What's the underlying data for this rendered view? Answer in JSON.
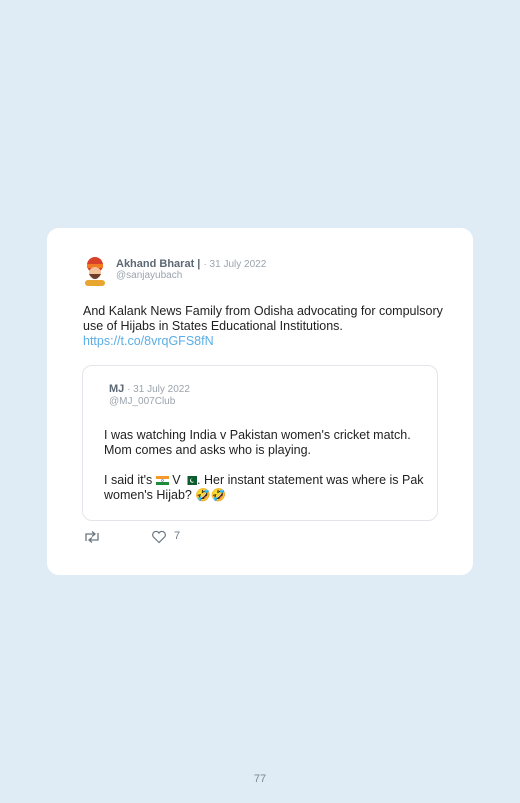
{
  "tweet": {
    "author_name": "Akhand Bharat |",
    "date": "· 31 July 2022",
    "handle": "@sanjayubach",
    "text": "And Kalank News Family from Odisha advocating for compulsory use of Hijabs in States Educational Institutions.",
    "link": "https://t.co/8vrqGFS8fN",
    "likes": "7"
  },
  "quoted": {
    "author_name": "MJ",
    "date": "· 31 July 2022",
    "handle": "@MJ_007Club",
    "para1": "I was watching India v Pakistan women's cricket match. Mom comes and asks who is playing.",
    "para2_start": "I said it's",
    "para2_mid": "V",
    "para2_end": ". Her instant statement was where is Pak women's Hijab?",
    "emoji": "🤣🤣"
  },
  "icons": {
    "avatar": "avatar-cartoon-turban",
    "retweet": "retweet-icon",
    "like": "heart-icon",
    "flag_india": "india-flag-icon",
    "flag_pakistan": "pakistan-flag-icon"
  },
  "colors": {
    "background": "#dfecf5",
    "card": "#ffffff",
    "link": "#5aaee6"
  },
  "page": {
    "number": "77"
  }
}
